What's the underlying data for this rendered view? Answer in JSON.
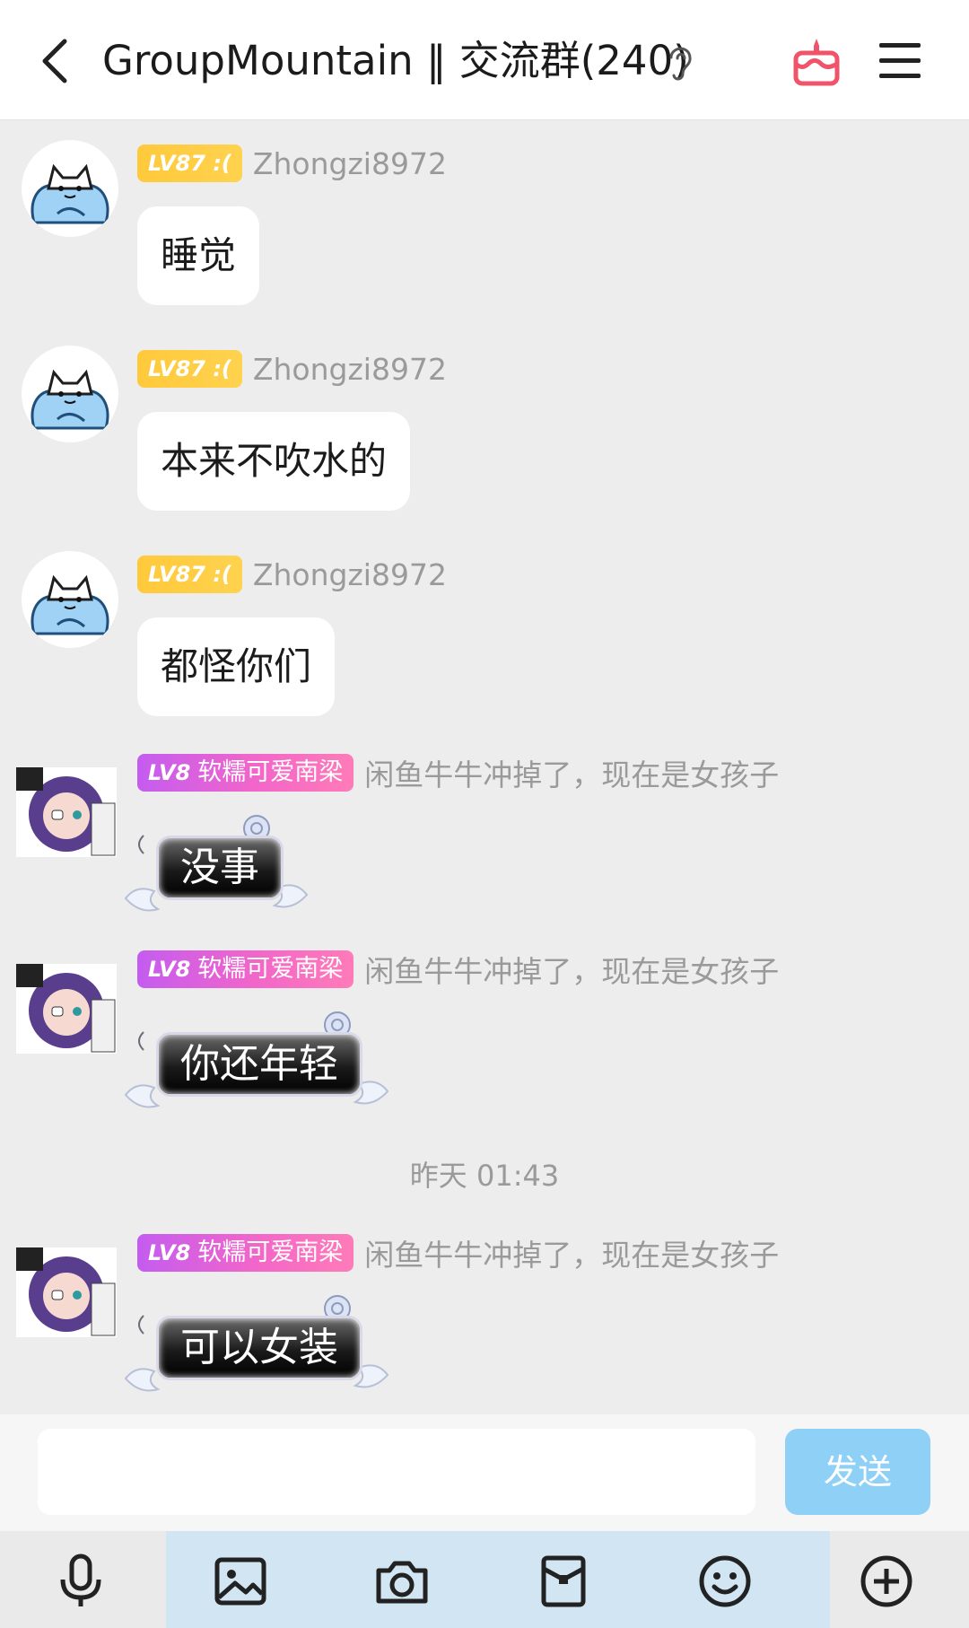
{
  "header": {
    "title": "GroupMountain ‖ 交流群(240)",
    "icons": [
      "back-arrow-icon",
      "ear-icon",
      "cake-icon",
      "menu-icon"
    ]
  },
  "users": {
    "user1": {
      "level_badge": "LV87 :(",
      "name": "Zhongzi8972"
    },
    "user2": {
      "level": "LV8",
      "title": "软糯可爱南梁",
      "name": "闲鱼牛牛冲掉了，现在是女孩子"
    }
  },
  "messages": [
    {
      "text": "睡觉"
    },
    {
      "text": "本来不吹水的"
    },
    {
      "text": "都怪你们"
    },
    {
      "text": "没事"
    },
    {
      "text": "你还年轻"
    },
    {
      "text": "可以女装"
    }
  ],
  "timestamp": "昨天 01:43",
  "composer": {
    "send_label": "发送",
    "value": ""
  },
  "toolbar": [
    "microphone-icon",
    "image-icon",
    "camera-icon",
    "red-packet-icon",
    "emoji-icon",
    "plus-icon"
  ],
  "colors": {
    "accent": "#8fd0f7",
    "gold_badge": "#ffc93b",
    "pink_badge": "#f266c9",
    "cake": "#f0546a"
  }
}
